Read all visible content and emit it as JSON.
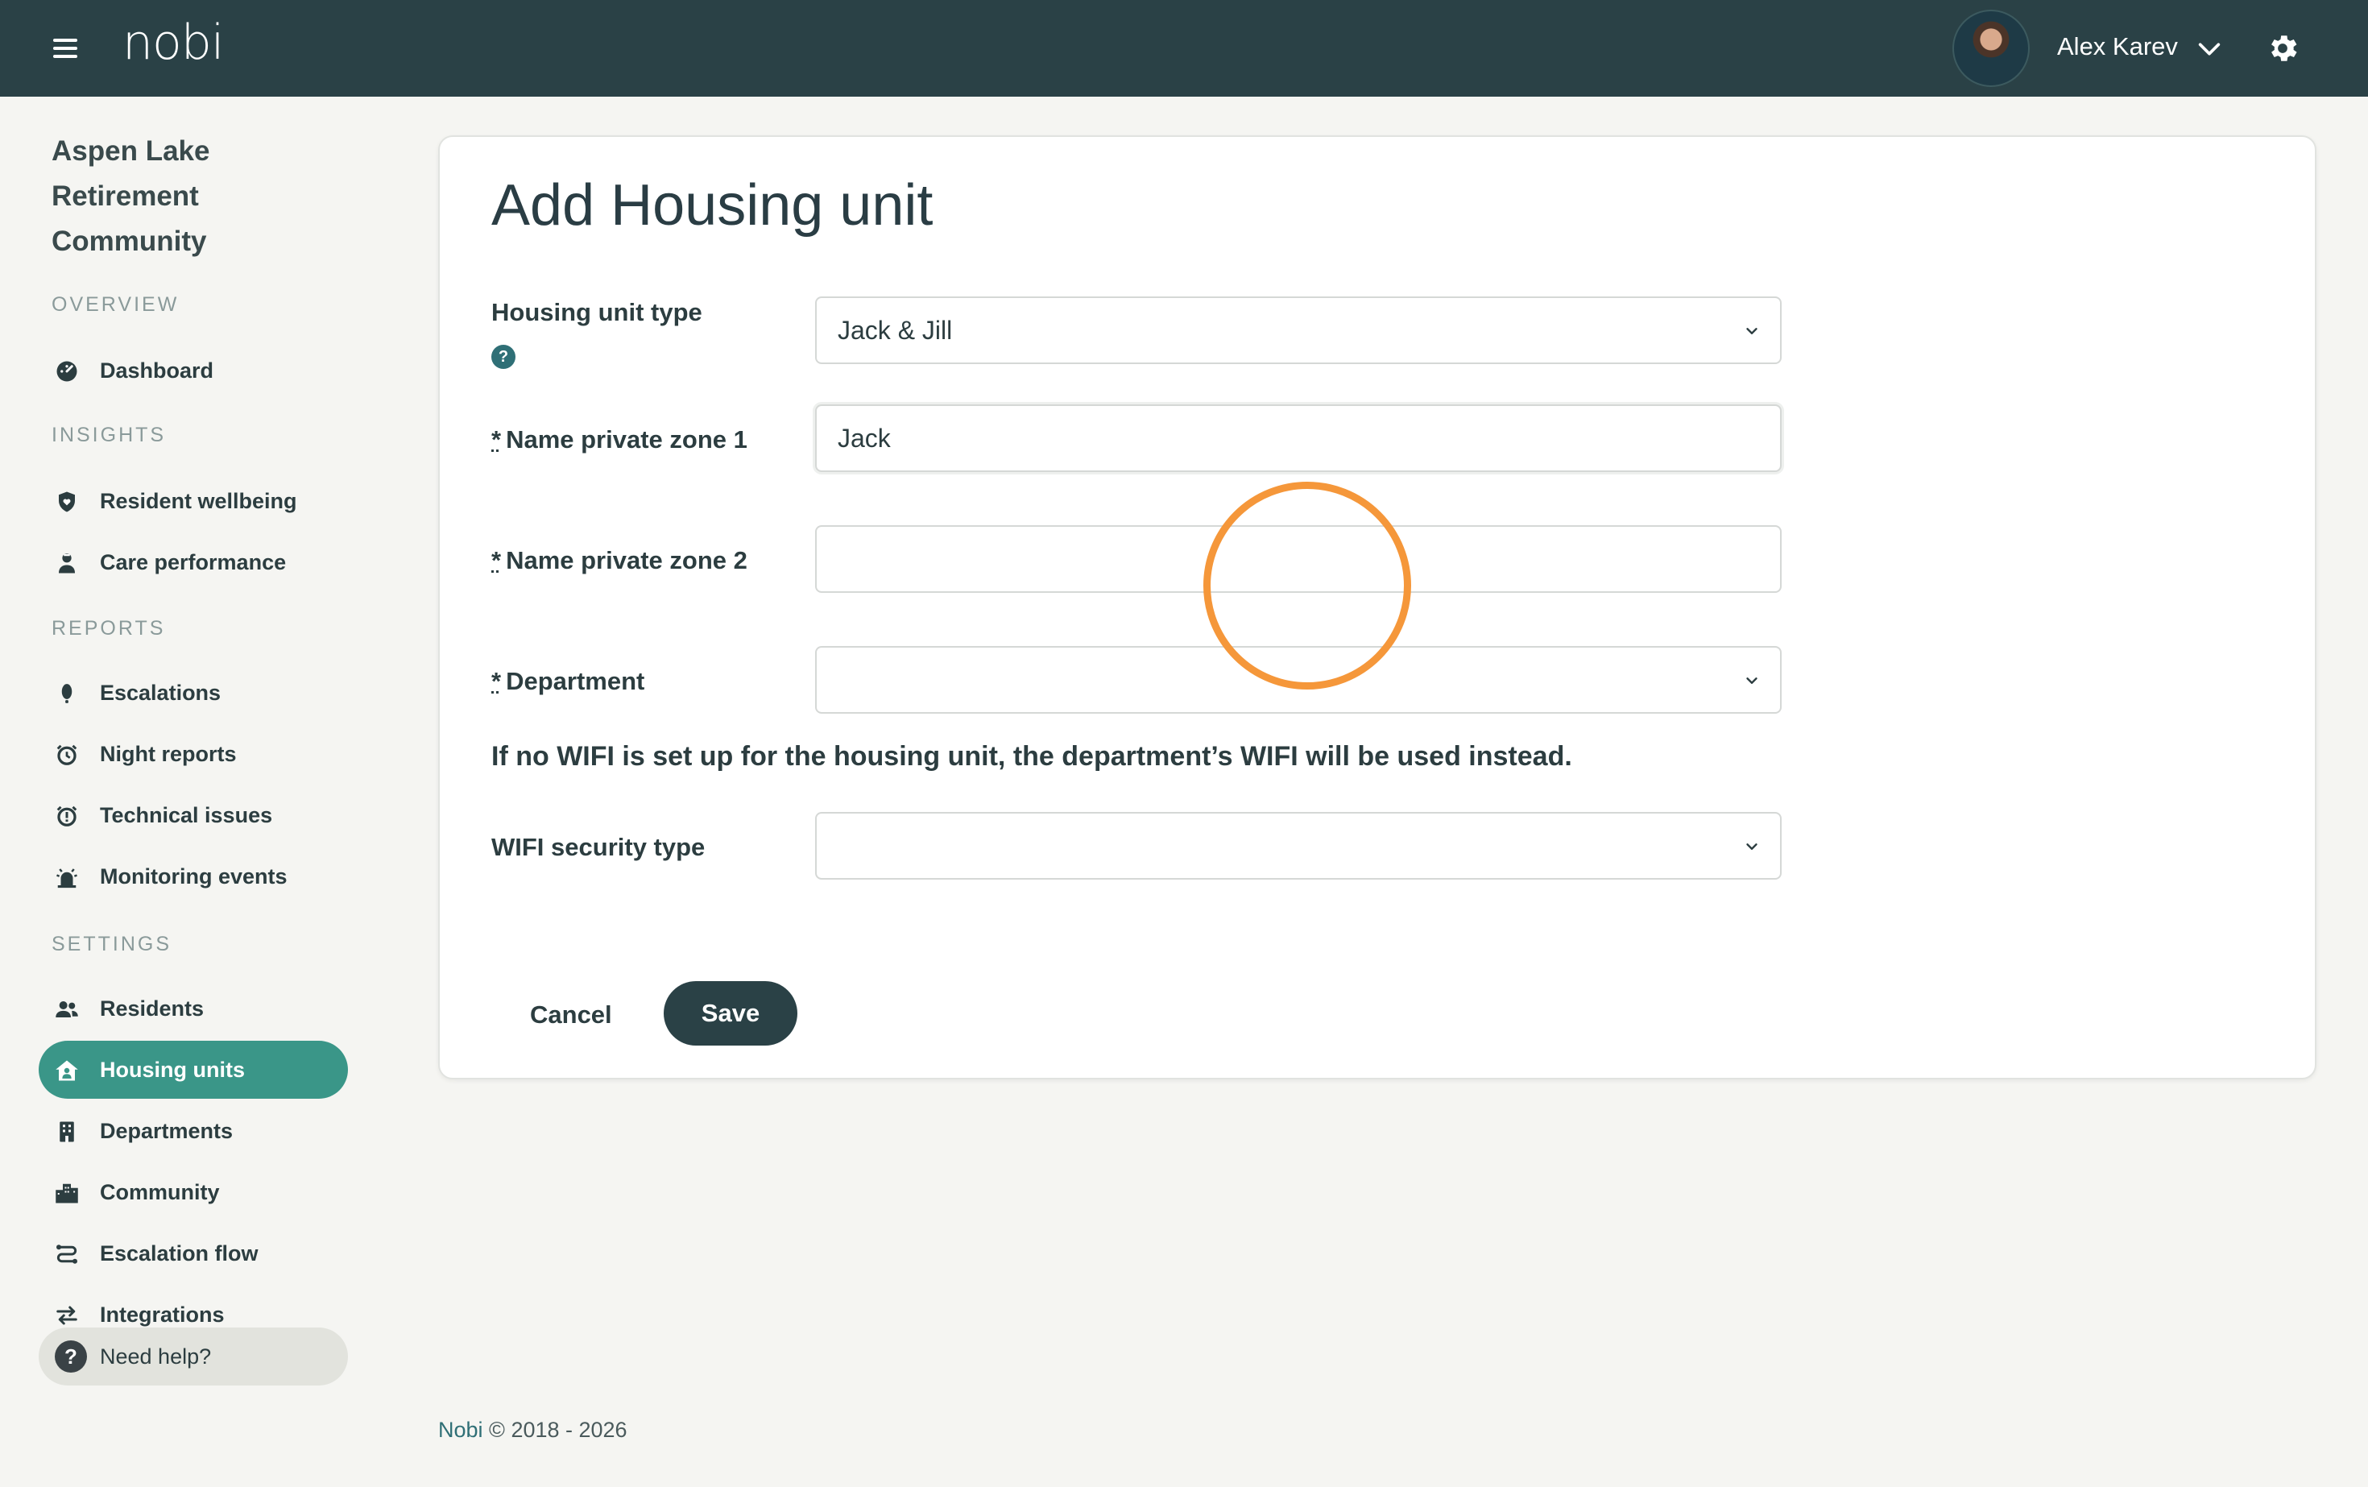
{
  "topbar": {
    "logo": "nobi",
    "user_name": "Alex Karev"
  },
  "sidebar": {
    "community_name": "Aspen Lake Retirement Community",
    "sections": {
      "overview": "OVERVIEW",
      "insights": "INSIGHTS",
      "reports": "REPORTS",
      "settings": "SETTINGS"
    },
    "items": {
      "dashboard": "Dashboard",
      "resident_wellbeing": "Resident wellbeing",
      "care_performance": "Care performance",
      "escalations": "Escalations",
      "night_reports": "Night reports",
      "technical_issues": "Technical issues",
      "monitoring_events": "Monitoring events",
      "residents": "Residents",
      "housing_units": "Housing units",
      "departments": "Departments",
      "community": "Community",
      "escalation_flow": "Escalation flow",
      "integrations": "Integrations"
    },
    "active_item": "Housing units",
    "help": "Need help?",
    "help_icon": "?"
  },
  "form": {
    "title": "Add Housing unit",
    "housing_unit_type_label": "Housing unit type",
    "housing_unit_type_value": "Jack & Jill",
    "help_icon": "?",
    "required_mark": "*",
    "zone1_label": "Name private zone 1",
    "zone1_value": "Jack",
    "zone2_label": "Name private zone 2",
    "zone2_value": "",
    "department_label": "Department",
    "department_value": "",
    "wifi_note": "If no WIFI is set up for the housing unit, the department’s WIFI will be used instead.",
    "wifi_security_label": "WIFI security type",
    "wifi_security_value": "",
    "cancel_label": "Cancel",
    "save_label": "Save"
  },
  "footer": {
    "brand": "Nobi",
    "copyright": "© 2018 - 2026"
  },
  "colors": {
    "topbar": "#2a4146",
    "accent": "#3a9688",
    "highlight": "#f5973a",
    "save_button": "#2a4146"
  }
}
